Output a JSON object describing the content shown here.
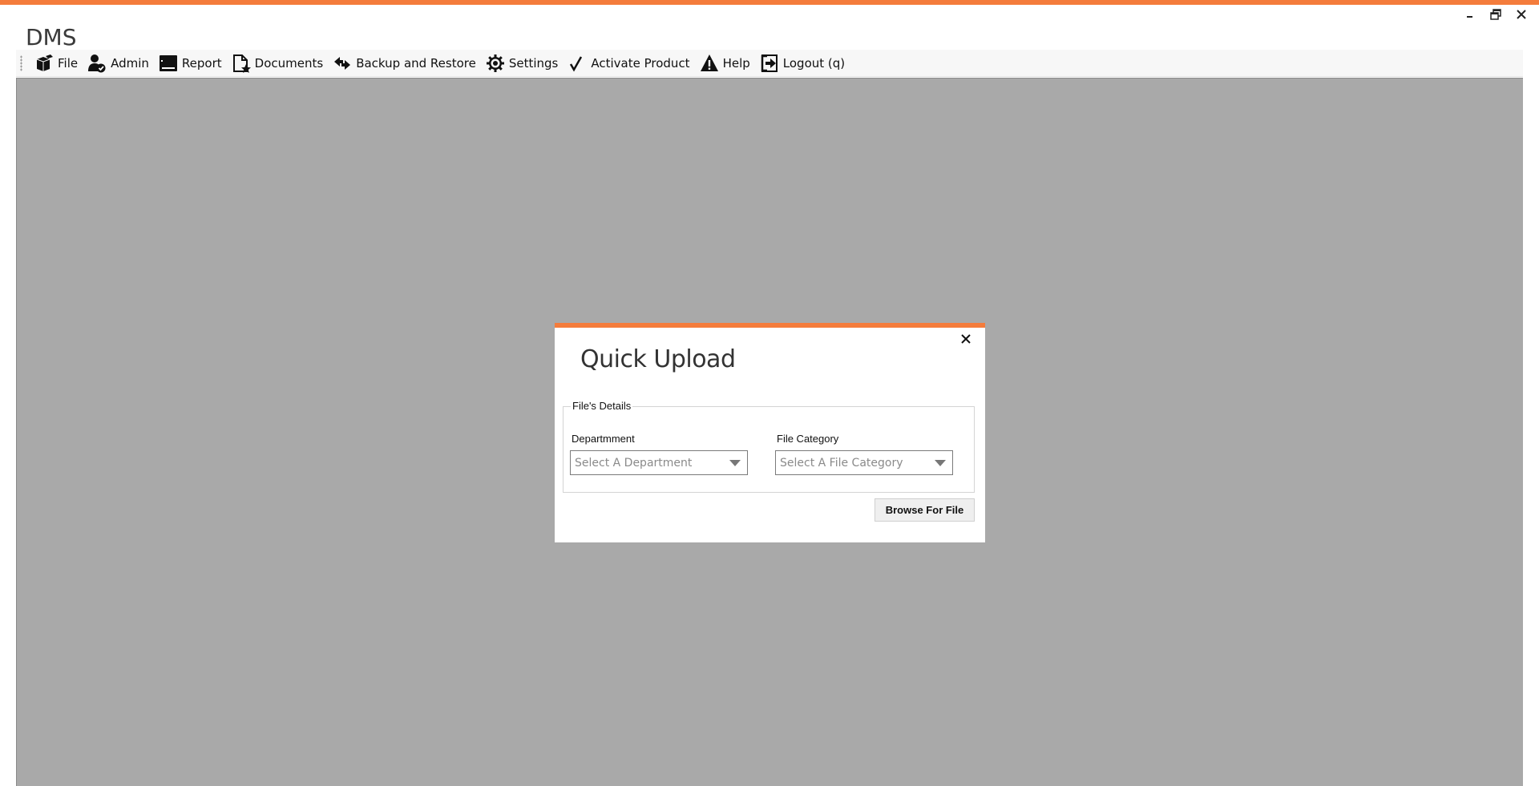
{
  "app": {
    "title": "DMS",
    "accent_color": "#f47c3c",
    "workspace_color": "#a9a9a9"
  },
  "window_controls": {
    "minimize_icon": "minimize-icon",
    "restore_icon": "restore-icon",
    "close_icon": "close-icon"
  },
  "menu": {
    "items": [
      {
        "label": "File",
        "icon": "file-boxes-icon"
      },
      {
        "label": "Admin",
        "icon": "admin-user-icon"
      },
      {
        "label": "Report",
        "icon": "report-icon"
      },
      {
        "label": "Documents",
        "icon": "documents-icon"
      },
      {
        "label": "Backup and Restore",
        "icon": "backup-restore-icon"
      },
      {
        "label": "Settings",
        "icon": "gear-icon"
      },
      {
        "label": "Activate Product",
        "icon": "checkmark-icon"
      },
      {
        "label": "Help",
        "icon": "warning-triangle-icon"
      },
      {
        "label": "Logout (q)",
        "icon": "logout-icon"
      }
    ]
  },
  "dialog": {
    "title": "Quick Upload",
    "close_icon": "close-icon",
    "group_label": "File's Details",
    "department": {
      "label": "Departmment",
      "placeholder": "Select A Department"
    },
    "file_category": {
      "label": "File Category",
      "placeholder": "Select A File Category"
    },
    "browse_button_label": "Browse For File"
  }
}
